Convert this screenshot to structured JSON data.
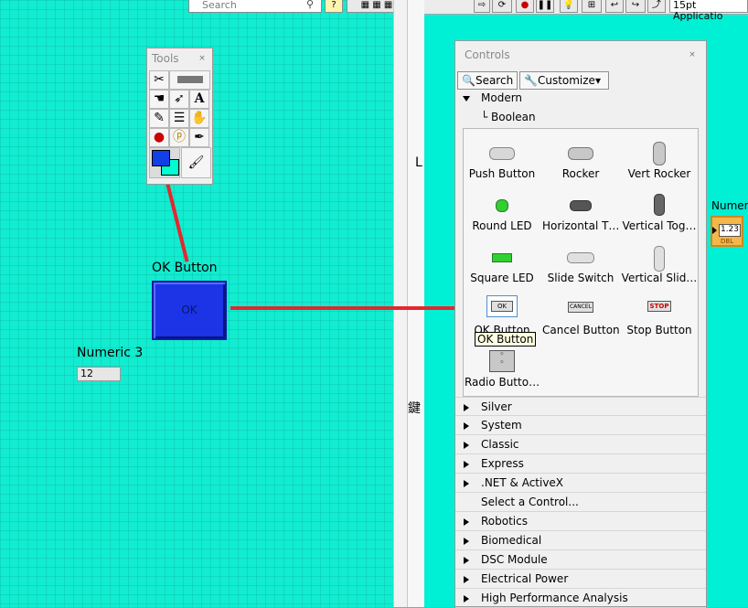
{
  "toolbar_left": {
    "search_placeholder": "Search"
  },
  "toolbar_right": {
    "font_label": "15pt Applicatio"
  },
  "front_panel": {
    "ok_button": {
      "label": "OK Button",
      "caption": "OK"
    },
    "numeric": {
      "label": "Numeric 3",
      "value": "12"
    }
  },
  "block_diagram": {
    "fragment_L": "L",
    "fragment_key": "鍵",
    "numeric_label": "Numeri",
    "numeric_value": "1.23",
    "numeric_type": "DBL"
  },
  "tools_palette": {
    "title": "Tools"
  },
  "controls_palette": {
    "title": "Controls",
    "search_label": "Search",
    "customize_label": "Customize▾",
    "modern_label": "Modern",
    "boolean_label": "Boolean",
    "items": [
      {
        "label": "Push Button",
        "icon": "push-button-icon"
      },
      {
        "label": "Rocker",
        "icon": "rocker-icon"
      },
      {
        "label": "Vert Rocker",
        "icon": "vert-rocker-icon"
      },
      {
        "label": "Round LED",
        "icon": "round-led-icon"
      },
      {
        "label": "Horizontal T…",
        "icon": "horizontal-toggle-icon"
      },
      {
        "label": "Vertical Tog…",
        "icon": "vertical-toggle-icon"
      },
      {
        "label": "Square LED",
        "icon": "square-led-icon"
      },
      {
        "label": "Slide Switch",
        "icon": "slide-switch-icon"
      },
      {
        "label": "Vertical Slid…",
        "icon": "vertical-slide-icon"
      },
      {
        "label": "OK Button",
        "icon": "ok-button-icon",
        "icon_text": "OK"
      },
      {
        "label": "Cancel Button",
        "icon": "cancel-button-icon",
        "icon_text": "CANCEL"
      },
      {
        "label": "Stop Button",
        "icon": "stop-button-icon",
        "icon_text": "STOP"
      },
      {
        "label": "Radio Butto…",
        "icon": "radio-buttons-icon"
      }
    ],
    "tooltip": "OK Button",
    "categories": [
      "Silver",
      "System",
      "Classic",
      "Express",
      ".NET & ActiveX",
      "Select a Control...",
      "Robotics",
      "Biomedical",
      "DSC Module",
      "Electrical Power",
      "High Performance Analysis"
    ]
  },
  "colors": {
    "canvas": "#12ecd0",
    "wire": "#e6262d",
    "ok_button_fill": "#1c34e6"
  }
}
